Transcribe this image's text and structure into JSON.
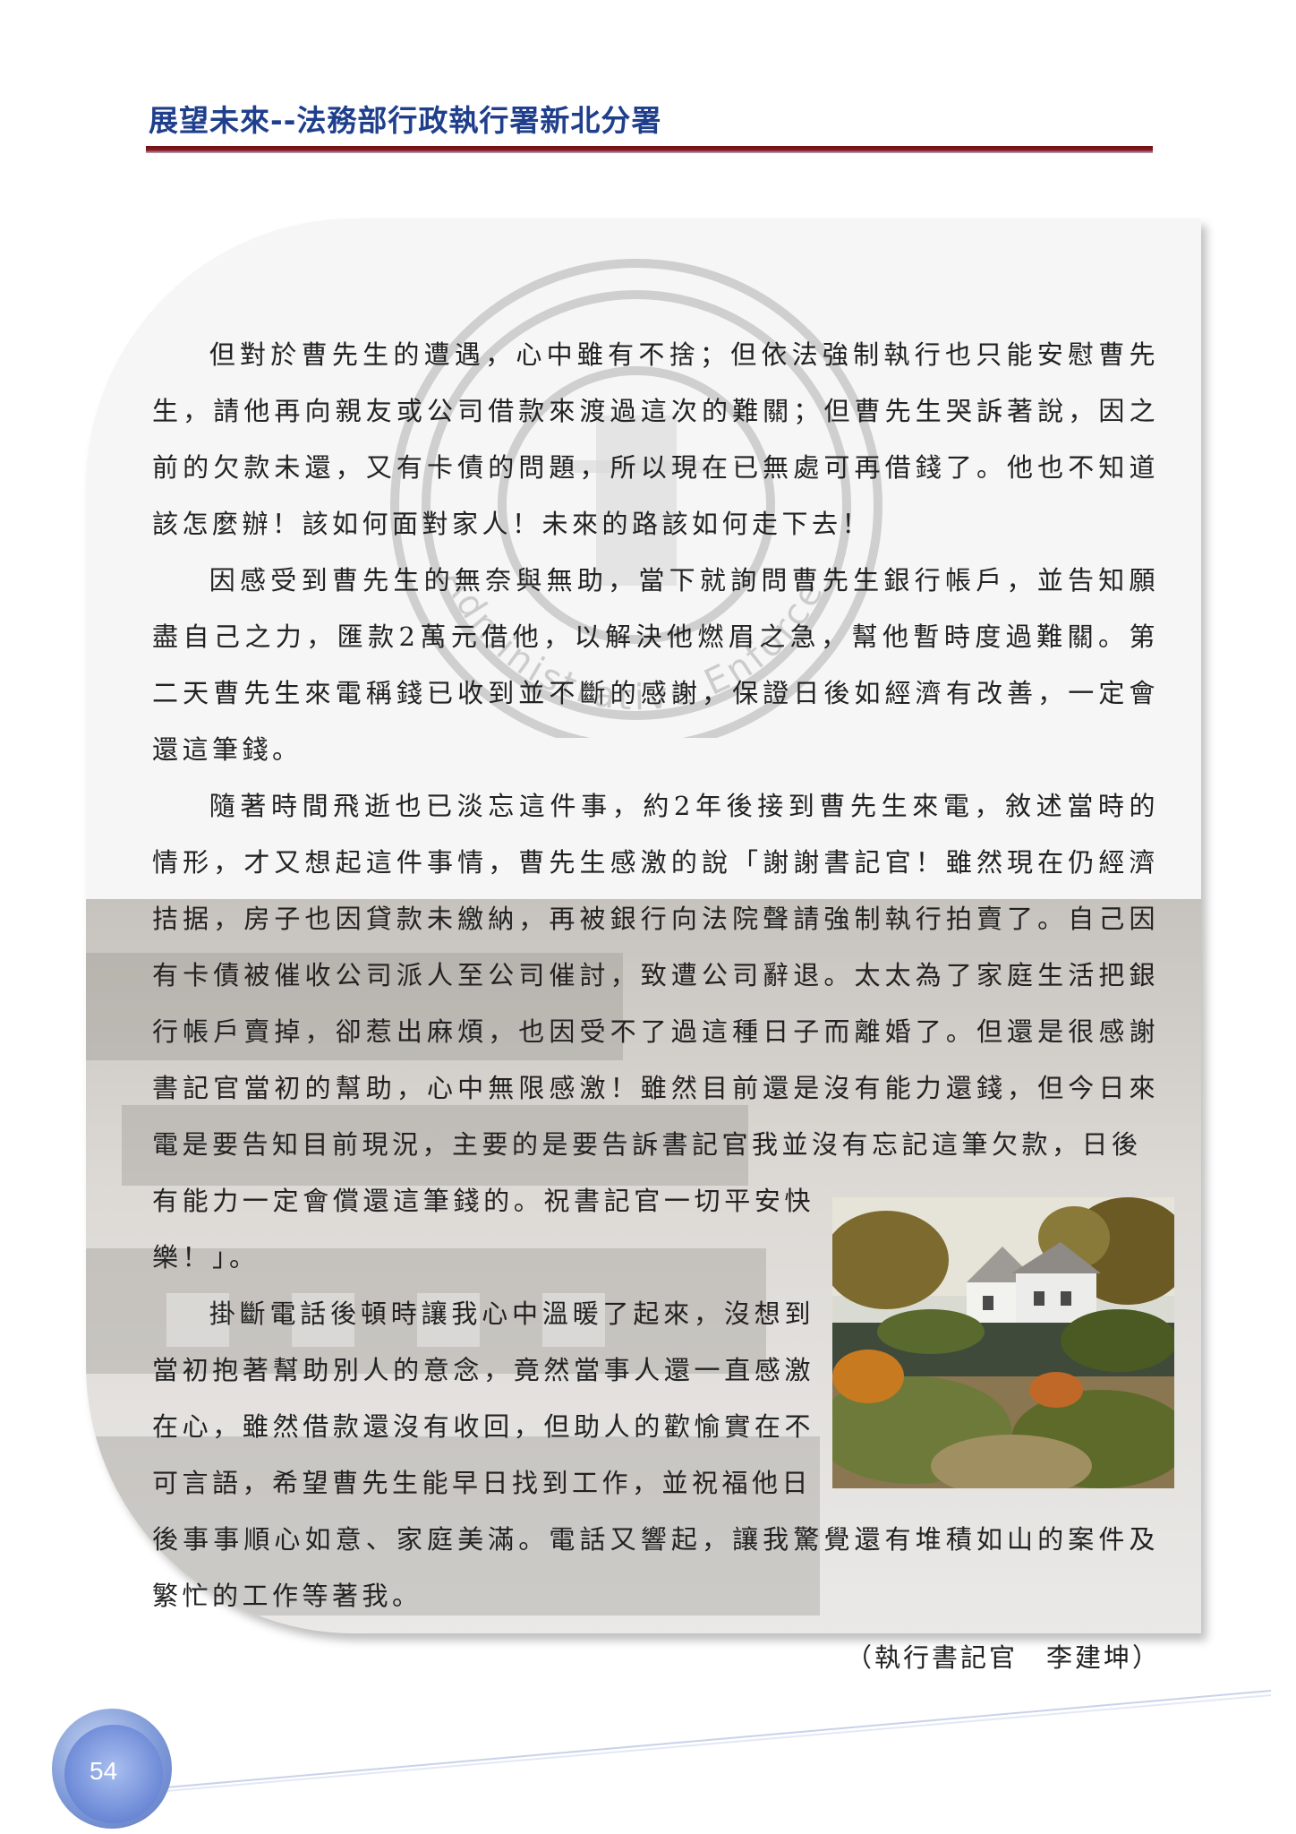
{
  "header": {
    "title": "展望未來--法務部行政執行署新北分署"
  },
  "article": {
    "paragraphs": [
      "但對於曹先生的遭遇，心中雖有不捨；但依法強制執行也只能安慰曹先生，請他再向親友或公司借款來渡過這次的難關；但曹先生哭訴著說，因之前的欠款未還，又有卡債的問題，所以現在已無處可再借錢了。他也不知道該怎麼辦！該如何面對家人！未來的路該如何走下去！",
      "因感受到曹先生的無奈與無助，當下就詢問曹先生銀行帳戶，並告知願盡自己之力，匯款2萬元借他，以解決他燃眉之急，幫他暫時度過難關。第二天曹先生來電稱錢已收到並不斷的感謝，保證日後如經濟有改善，一定會還這筆錢。",
      "隨著時間飛逝也已淡忘這件事，約2年後接到曹先生來電，敘述當時的情形，才又想起這件事情，曹先生感激的說「謝謝書記官！雖然現在仍經濟拮据，房子也因貸款未繳納，再被銀行向法院聲請強制執行拍賣了。自己因有卡債被催收公司派人至公司催討，致遭公司辭退。太太為了家庭生活把銀行帳戶賣掉，卻惹出麻煩，也因受不了過這種日子而離婚了。但還是很感謝書記官當初的幫助，心中無限感激！雖然目前還是沒有能力還錢，但今日來電是要告知目前現況，主要的是要告訴書記官我並沒有忘記這筆欠款，日後",
      "有能力一定會償還這筆錢的。祝書記官一切平安快樂！」。",
      "掛斷電話後頓時讓我心中溫暖了起來，沒想到當初抱著幫助別人的意念，竟然當事人還一直感激在心，雖然借款還沒有收回，但助人的歡愉實在不可言語，希望曹先生能早日找到工作，並祝福他日",
      "後事事順心如意、家庭美滿。電話又響起，讓我驚覺還有堆積如山的案件及繁忙的工作等著我。"
    ],
    "seal_text": "Administrative Enforcement Agency"
  },
  "author": "（執行書記官　李建坤）",
  "footer": {
    "page_number": "54"
  },
  "colors": {
    "title": "#1f3f8c",
    "rule": "#6b0f14",
    "page_circle": "#6b88d6"
  }
}
